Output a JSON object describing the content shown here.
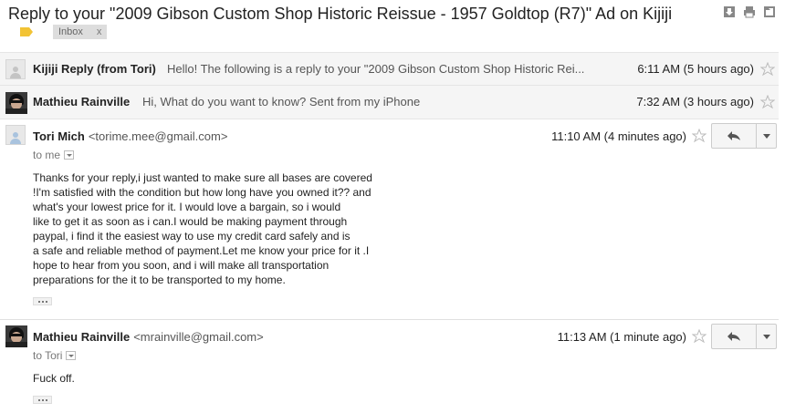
{
  "subject": "Reply to your \"2009 Gibson Custom Shop Historic Reissue - 1957 Goldtop (R7)\" Ad on Kijiji",
  "label": {
    "name": "Inbox",
    "remove": "x"
  },
  "top_icons": [
    "download-icon",
    "print-icon",
    "new-window-icon"
  ],
  "collapsed": [
    {
      "sender": "Kijiji Reply (from Tori)",
      "snippet": "Hello! The following is a reply to your \"2009 Gibson Custom Shop Historic Rei...",
      "time": "6:11 AM (5 hours ago)"
    },
    {
      "sender": "Mathieu Rainville",
      "snippet": "Hi, What do you want to know? Sent from my iPhone",
      "time": "7:32 AM (3 hours ago)"
    }
  ],
  "messages": [
    {
      "sender": "Tori Mich",
      "email": "<torime.mee@gmail.com>",
      "to": "to me",
      "time": "11:10 AM (4 minutes ago)",
      "body": [
        "Thanks for your reply,i just wanted to make sure all bases are covered",
        "!I'm satisfied with the condition but how long have you owned it?? and",
        "what's your lowest price for it. I would love a bargain, so i would",
        "like to get it as soon as i can.I would be making payment through",
        "paypal, i find it the easiest way to use my credit card safely and is",
        "a safe and reliable method of payment.Let me know your price for it .I",
        "hope to hear from you soon, and i will make all transportation",
        "preparations for the it to be transported to my home."
      ]
    },
    {
      "sender": "Mathieu Rainville",
      "email": "<mrainville@gmail.com>",
      "to": "to Tori",
      "time": "11:13 AM (1 minute ago)",
      "body": [
        "Fuck off."
      ]
    }
  ]
}
